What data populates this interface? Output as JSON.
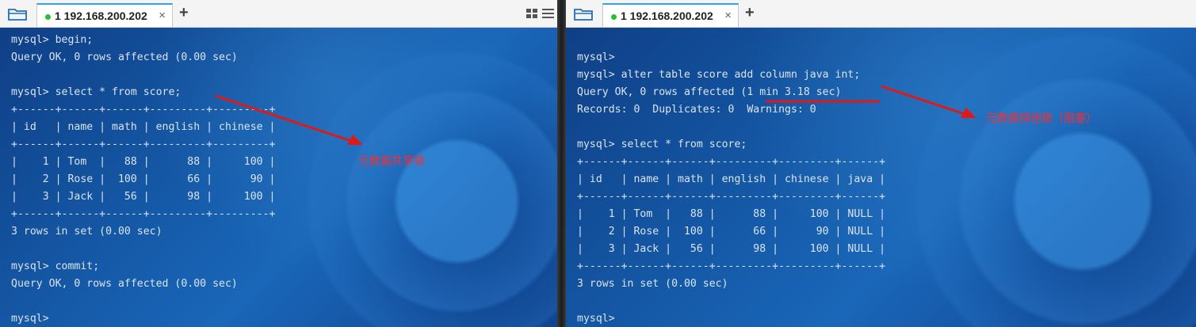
{
  "left": {
    "tab_title": "1 192.168.200.202",
    "close_glyph": "×",
    "add_glyph": "+",
    "lines": [
      "mysql> begin;",
      "Query OK, 0 rows affected (0.00 sec)",
      "",
      "mysql> select * from score;",
      "+------+------+------+---------+---------+",
      "| id   | name | math | english | chinese |",
      "+------+------+------+---------+---------+",
      "|    1 | Tom  |   88 |      88 |     100 |",
      "|    2 | Rose |  100 |      66 |      90 |",
      "|    3 | Jack |   56 |      98 |     100 |",
      "+------+------+------+---------+---------+",
      "3 rows in set (0.00 sec)",
      "",
      "mysql> commit;",
      "Query OK, 0 rows affected (0.00 sec)",
      "",
      "mysql>"
    ],
    "annotation": "元数据共享锁"
  },
  "right": {
    "tab_title": "1 192.168.200.202",
    "close_glyph": "×",
    "add_glyph": "+",
    "lines": [
      "",
      "mysql>",
      "mysql> alter table score add column java int;",
      "Query OK, 0 rows affected (1 min 3.18 sec)",
      "Records: 0  Duplicates: 0  Warnings: 0",
      "",
      "mysql> select * from score;",
      "+------+------+------+---------+---------+------+",
      "| id   | name | math | english | chinese | java |",
      "+------+------+------+---------+---------+------+",
      "|    1 | Tom  |   88 |      88 |     100 | NULL |",
      "|    2 | Rose |  100 |      66 |      90 | NULL |",
      "|    3 | Jack |   56 |      98 |     100 | NULL |",
      "+------+------+------+---------+---------+------+",
      "3 rows in set (0.00 sec)",
      "",
      "mysql>"
    ],
    "annotation": "元数据排他锁（阻塞）"
  },
  "colors": {
    "annotation": "#ff2a2a",
    "terminal_text": "#d9e4ef",
    "tab_active_dot": "#2cbc3a"
  },
  "icons": [
    "folder-icon",
    "add-tab-icon",
    "layout-grid-icon",
    "menu-icon",
    "close-icon"
  ]
}
